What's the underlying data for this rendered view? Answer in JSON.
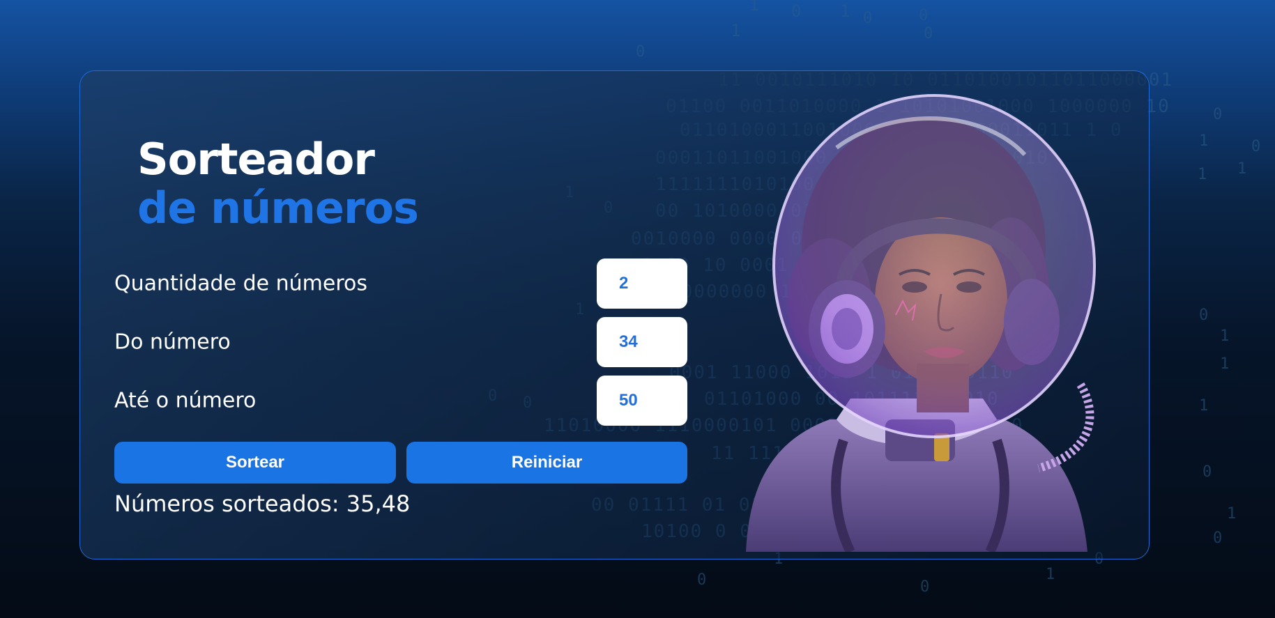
{
  "title": {
    "line1": "Sorteador",
    "line2": "de números"
  },
  "form": {
    "quantity": {
      "label": "Quantidade de números",
      "value": "2"
    },
    "from": {
      "label": "Do número",
      "value": "34"
    },
    "to": {
      "label": "Até o número",
      "value": "50"
    }
  },
  "buttons": {
    "draw_label": "Sortear",
    "reset_label": "Reiniciar"
  },
  "result": {
    "text": "Números sorteados: 35,48"
  },
  "colors": {
    "accent": "#1f74e6",
    "button": "#1b74e4",
    "card_border": "#1e6ad6",
    "input_text": "#1f6fdc"
  },
  "illustration": {
    "subject": "astronaut-with-headphones"
  }
}
